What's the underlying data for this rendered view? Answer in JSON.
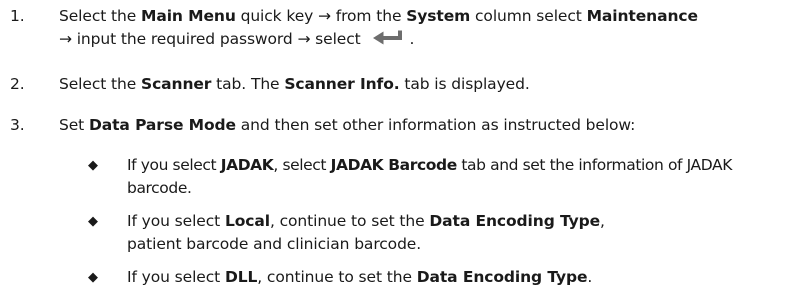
{
  "steps": [
    {
      "number": "1.",
      "parts": {
        "t1": "Select the ",
        "b1": "Main Menu",
        "t2": " quick key → from the ",
        "b2": "System",
        "t3": " column select ",
        "b3": "Maintenance",
        "t4": "→ input the required password → select ",
        "t5": "."
      }
    },
    {
      "number": "2.",
      "parts": {
        "t1": "Select the ",
        "b1": "Scanner",
        "t2": " tab. The ",
        "b2": "Scanner Info.",
        "t3": " tab is displayed."
      }
    },
    {
      "number": "3.",
      "parts": {
        "t1": "Set ",
        "b1": "Data Parse Mode",
        "t2": " and then set other information as instructed below:"
      }
    }
  ],
  "bullet_symbol": "◆",
  "bullets": [
    {
      "t1": "If you select ",
      "b1": "JADAK",
      "t2": ", select ",
      "b2": "JADAK Barcode",
      "t3": " tab and set the information of JADAK barcode."
    },
    {
      "t1": "If you select ",
      "b1": "Local",
      "t2": ", continue to set the ",
      "b2": "Data Encoding Type",
      "t3": ", patient barcode and clinician barcode."
    },
    {
      "t1": "If you select ",
      "b1": "DLL",
      "t2": ", continue to set the ",
      "b2": "Data Encoding Type",
      "t3": "."
    }
  ],
  "icons": {
    "enter": "enter-key-icon"
  }
}
